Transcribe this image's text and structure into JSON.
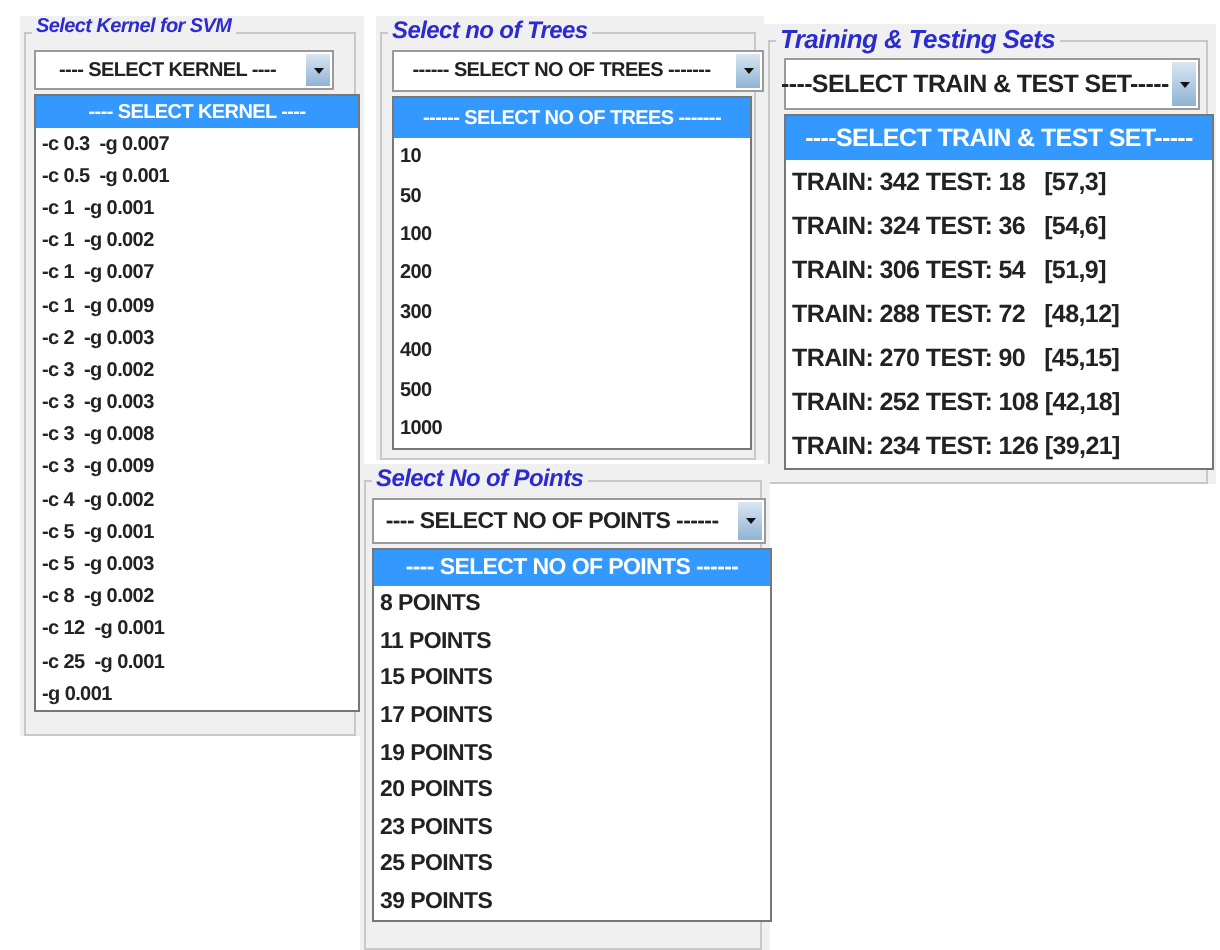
{
  "panels": [
    {
      "kind": "kernel",
      "label": "Select Kernel for SVM",
      "value": "---- SELECT KERNEL ----",
      "options": [
        {
          "text": "---- SELECT KERNEL ----",
          "selected": true
        },
        {
          "text": "-c 0.3  -g 0.007",
          "selected": false
        },
        {
          "text": "-c 0.5  -g 0.001",
          "selected": false
        },
        {
          "text": "-c 1  -g 0.001",
          "selected": false
        },
        {
          "text": "-c 1  -g 0.002",
          "selected": false
        },
        {
          "text": "-c 1  -g 0.007",
          "selected": false
        },
        {
          "text": "-c 1  -g 0.009",
          "selected": false
        },
        {
          "text": "-c 2  -g 0.003",
          "selected": false
        },
        {
          "text": "-c 3  -g 0.002",
          "selected": false
        },
        {
          "text": "-c 3  -g 0.003",
          "selected": false
        },
        {
          "text": "-c 3  -g 0.008",
          "selected": false
        },
        {
          "text": "-c 3  -g 0.009",
          "selected": false
        },
        {
          "text": "-c 4  -g 0.002",
          "selected": false
        },
        {
          "text": "-c 5  -g 0.001",
          "selected": false
        },
        {
          "text": "-c 5  -g 0.003",
          "selected": false
        },
        {
          "text": "-c 8  -g 0.002",
          "selected": false
        },
        {
          "text": "-c 12  -g 0.001",
          "selected": false
        },
        {
          "text": "-c 25  -g 0.001",
          "selected": false
        },
        {
          "text": "-g 0.001",
          "selected": false
        }
      ]
    },
    {
      "kind": "trees",
      "label": "Select no of Trees",
      "value": "------ SELECT NO OF TREES -------",
      "options": [
        {
          "text": "------ SELECT NO OF TREES -------",
          "selected": true
        },
        {
          "text": "10",
          "selected": false
        },
        {
          "text": "50",
          "selected": false
        },
        {
          "text": "100",
          "selected": false
        },
        {
          "text": "200",
          "selected": false
        },
        {
          "text": "300",
          "selected": false
        },
        {
          "text": "400",
          "selected": false
        },
        {
          "text": "500",
          "selected": false
        },
        {
          "text": "1000",
          "selected": false
        }
      ]
    },
    {
      "kind": "train",
      "label": "Training & Testing Sets",
      "value": "----SELECT TRAIN & TEST SET-----",
      "options": [
        {
          "text": "----SELECT TRAIN & TEST SET-----",
          "selected": true
        },
        {
          "text": "TRAIN: 342 TEST: 18   [57,3]",
          "selected": false
        },
        {
          "text": "TRAIN: 324 TEST: 36   [54,6]",
          "selected": false
        },
        {
          "text": "TRAIN: 306 TEST: 54   [51,9]",
          "selected": false
        },
        {
          "text": "TRAIN: 288 TEST: 72   [48,12]",
          "selected": false
        },
        {
          "text": "TRAIN: 270 TEST: 90   [45,15]",
          "selected": false
        },
        {
          "text": "TRAIN: 252 TEST: 108 [42,18]",
          "selected": false
        },
        {
          "text": "TRAIN: 234 TEST: 126 [39,21]",
          "selected": false
        }
      ]
    },
    {
      "kind": "points",
      "label": "Select No of Points",
      "value": "---- SELECT NO OF POINTS ------",
      "options": [
        {
          "text": "---- SELECT NO OF POINTS ------",
          "selected": true
        },
        {
          "text": "8 POINTS",
          "selected": false
        },
        {
          "text": "11 POINTS",
          "selected": false
        },
        {
          "text": "15 POINTS",
          "selected": false
        },
        {
          "text": "17 POINTS",
          "selected": false
        },
        {
          "text": "19 POINTS",
          "selected": false
        },
        {
          "text": "20 POINTS",
          "selected": false
        },
        {
          "text": "23 POINTS",
          "selected": false
        },
        {
          "text": "25 POINTS",
          "selected": false
        },
        {
          "text": "39 POINTS",
          "selected": false
        }
      ]
    }
  ]
}
